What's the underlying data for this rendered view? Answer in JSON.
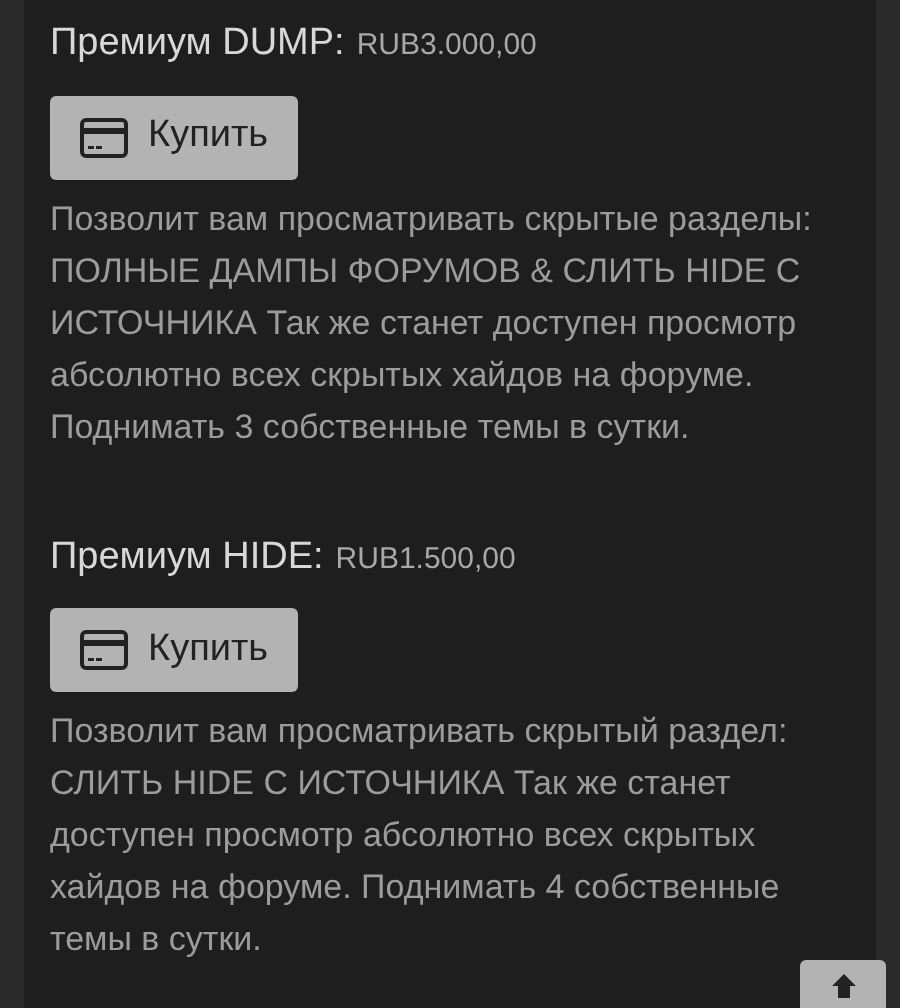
{
  "plans": [
    {
      "name": "Премиум DUMP:",
      "price": "RUB3.000,00",
      "button": "Купить",
      "description": "Позволит вам просматривать скрытые разделы: ПОЛНЫЕ ДАМПЫ ФОРУМОВ & СЛИТЬ HIDE С ИСТОЧНИКА Так же станет доступен просмотр абсолютно всех скрытых хайдов на форуме. Поднимать 3 собственные темы в сутки."
    },
    {
      "name": "Премиум HIDE:",
      "price": "RUB1.500,00",
      "button": "Купить",
      "description": "Позволит вам просматривать скрытый раздел: СЛИТЬ HIDE С ИСТОЧНИКА Так же станет доступен просмотр абсолютно всех скрытых хайдов на форуме. Поднимать 4 собственные темы в сутки."
    }
  ]
}
